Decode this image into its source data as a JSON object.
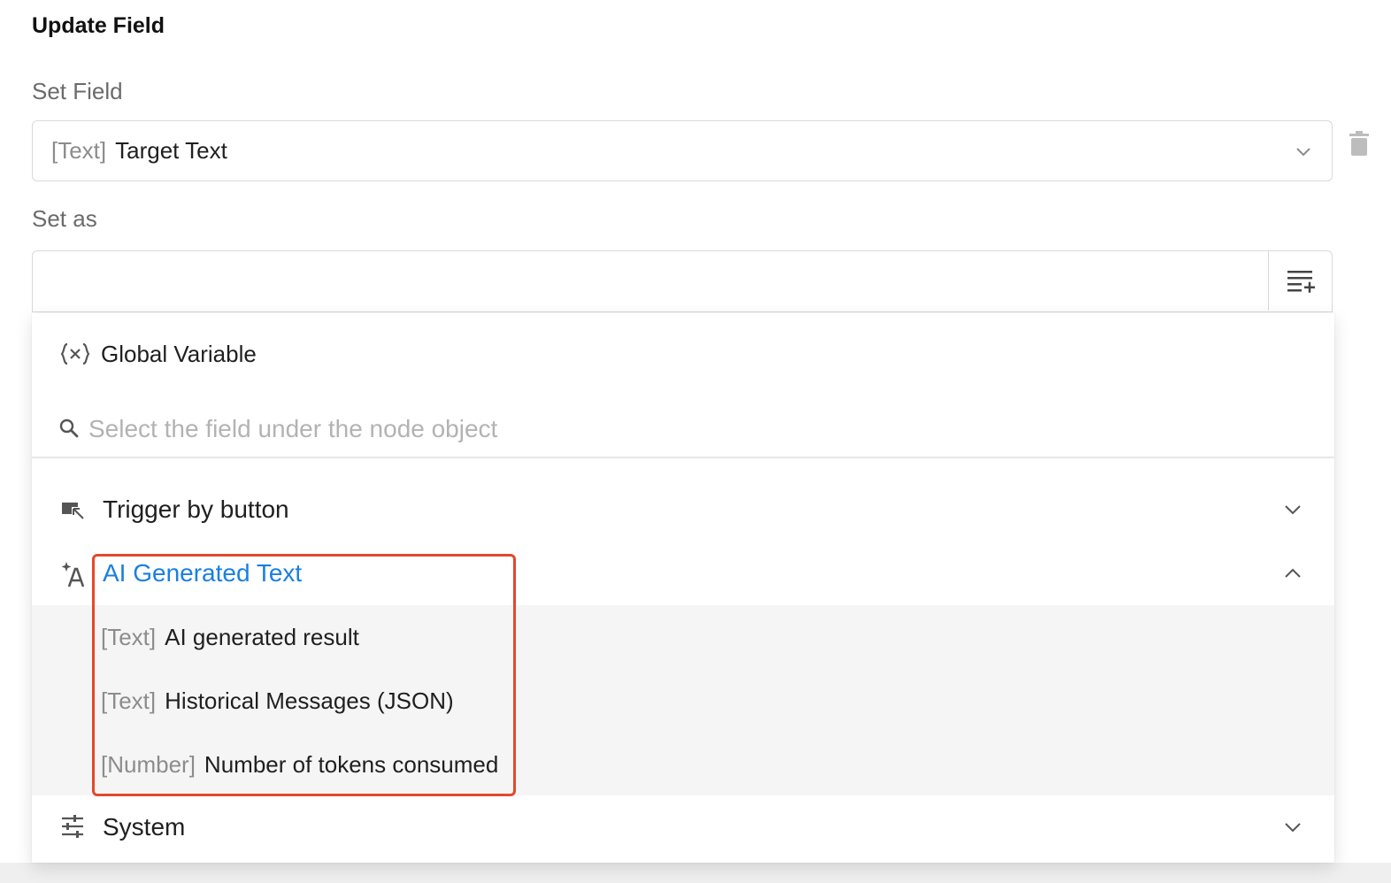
{
  "header": {
    "title": "Update Field"
  },
  "set_field": {
    "label": "Set Field",
    "type_tag": "[Text]",
    "value": "Target Text",
    "chevron_icon": "chevron-down-icon",
    "delete_icon": "trash-icon"
  },
  "set_as": {
    "label": "Set as",
    "input_value": "",
    "insert_icon": "insert-variable-icon"
  },
  "dropdown": {
    "global_variable": {
      "icon": "variable-braces-icon",
      "label": "Global Variable"
    },
    "search": {
      "icon": "search-icon",
      "placeholder": "Select the field under the node object"
    },
    "groups": [
      {
        "label": "Trigger by button",
        "icon": "button-cursor-icon",
        "expanded": false
      },
      {
        "label": "AI Generated Text",
        "icon": "ai-text-icon",
        "expanded": true,
        "items": [
          {
            "type": "[Text]",
            "name": "AI generated result"
          },
          {
            "type": "[Text]",
            "name": "Historical Messages (JSON)"
          },
          {
            "type": "[Number]",
            "name": "Number of tokens consumed"
          }
        ]
      },
      {
        "label": "System",
        "icon": "sliders-icon",
        "expanded": false
      }
    ]
  },
  "colors": {
    "accent_blue": "#1a7fe0",
    "highlight_red": "#e4482c",
    "muted_text": "#8c8c8c",
    "submenu_bg": "#f5f5f5"
  }
}
